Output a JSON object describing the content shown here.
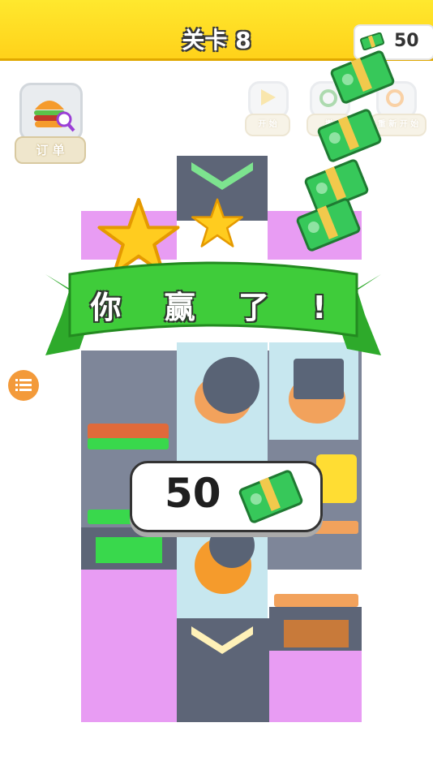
{
  "header": {
    "level_title": "关卡 8",
    "coins": "50"
  },
  "order_button": {
    "label": "订 单",
    "icon": "burger-magnifier-icon"
  },
  "controls": {
    "start_label": "开 始",
    "undo_label": "撤",
    "restart_label": "重 新 开 始"
  },
  "result": {
    "title": "你 赢 了 !",
    "stars_earned": 2,
    "reward_amount": "50",
    "reward_icon": "cash-bundle-icon"
  },
  "side_menu": {
    "icon": "list-menu-icon"
  },
  "colors": {
    "header_bg": "#ffd21a",
    "ribbon": "#3fcc3a",
    "board_purple": "#e89cf3",
    "cash_green": "#37c85a",
    "menu_orange": "#f39a3a"
  }
}
